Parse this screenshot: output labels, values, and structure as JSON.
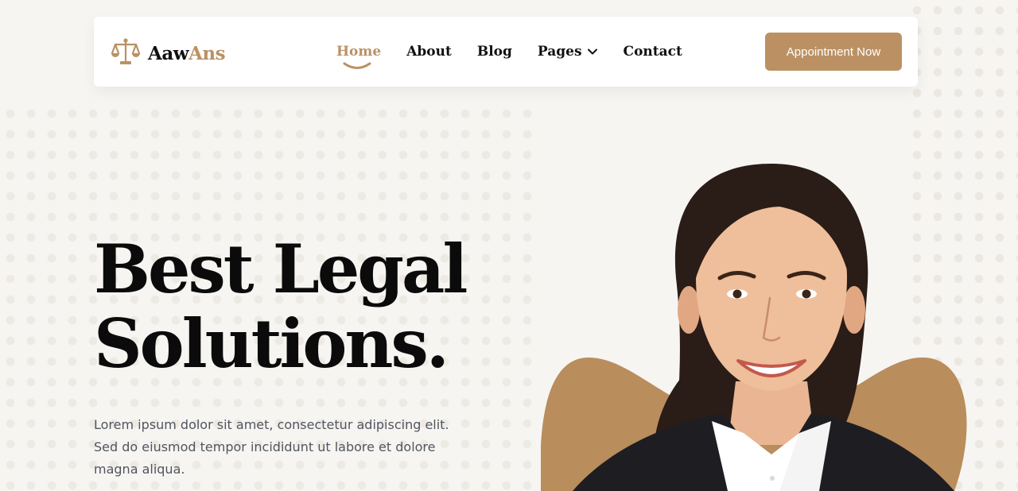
{
  "brand": {
    "name_part1": "Aaw",
    "name_part2": "Ans",
    "logo_icon": "scales-of-justice-icon",
    "accent_color": "#bb9164"
  },
  "nav": {
    "items": [
      {
        "label": "Home",
        "active": true
      },
      {
        "label": "About"
      },
      {
        "label": "Blog"
      },
      {
        "label": "Pages",
        "dropdown": true
      },
      {
        "label": "Contact"
      }
    ]
  },
  "cta": {
    "label": "Appointment Now"
  },
  "hero": {
    "title_line1": "Best Legal",
    "title_line2": "Solutions.",
    "text": "Lorem ipsum dolor sit amet, consectetur adipiscing elit. Sed do eiusmod tempor incididunt ut labore et dolore magna aliqua."
  }
}
